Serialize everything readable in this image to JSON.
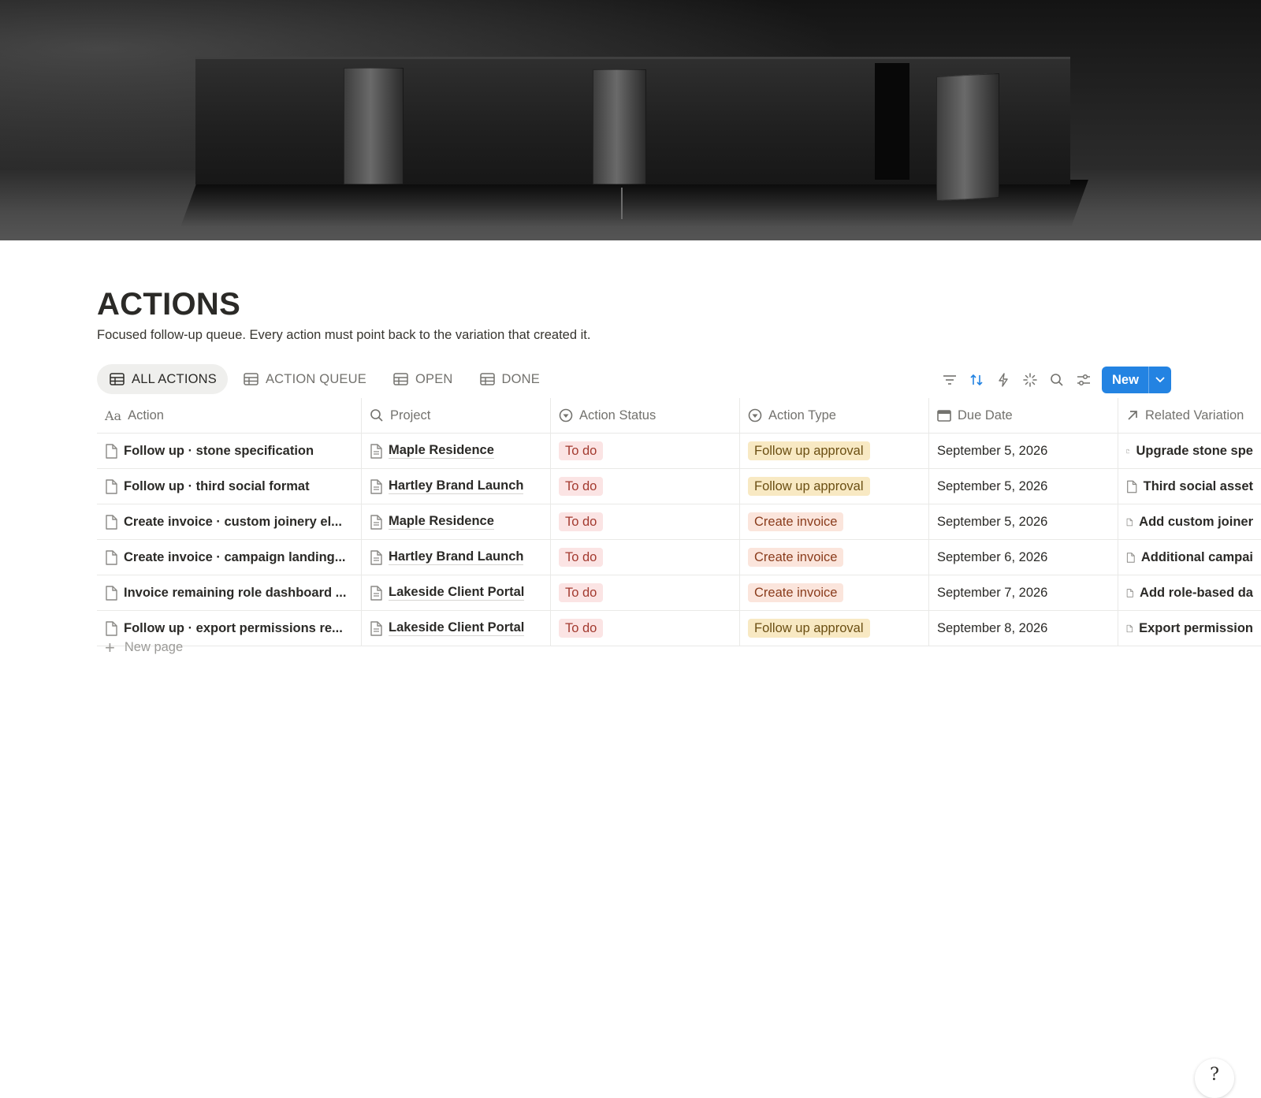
{
  "page": {
    "title": "ACTIONS",
    "description": "Focused follow-up queue. Every action must point back to the variation that created it."
  },
  "tabs": [
    {
      "label": "ALL ACTIONS",
      "active": true
    },
    {
      "label": "ACTION QUEUE",
      "active": false
    },
    {
      "label": "OPEN",
      "active": false
    },
    {
      "label": "DONE",
      "active": false
    }
  ],
  "toolbar": {
    "icons": [
      "filter-icon",
      "sort-icon",
      "automation-icon",
      "ai-sparkle-icon",
      "search-icon",
      "settings-icon"
    ],
    "new_label": "New",
    "accent": "#2383e2"
  },
  "columns": [
    {
      "label": "Action",
      "icon": "title-icon"
    },
    {
      "label": "Project",
      "icon": "search-icon"
    },
    {
      "label": "Action Status",
      "icon": "status-icon"
    },
    {
      "label": "Action Type",
      "icon": "select-icon"
    },
    {
      "label": "Due Date",
      "icon": "calendar-icon"
    },
    {
      "label": "Related Variation",
      "icon": "relation-arrow-icon"
    }
  ],
  "rows": [
    {
      "action": "Follow up · stone specification",
      "project": "Maple Residence",
      "status": "To do",
      "type": "Follow up approval",
      "type_color": "yellow",
      "due": "September 5, 2026",
      "variation": "Upgrade stone spe"
    },
    {
      "action": "Follow up · third social format",
      "project": "Hartley Brand Launch",
      "status": "To do",
      "type": "Follow up approval",
      "type_color": "yellow",
      "due": "September 5, 2026",
      "variation": "Third social asset"
    },
    {
      "action": "Create invoice · custom joinery el...",
      "project": "Maple Residence",
      "status": "To do",
      "type": "Create invoice",
      "type_color": "orange",
      "due": "September 5, 2026",
      "variation": "Add custom joiner"
    },
    {
      "action": "Create invoice · campaign landing...",
      "project": "Hartley Brand Launch",
      "status": "To do",
      "type": "Create invoice",
      "type_color": "orange",
      "due": "September 6, 2026",
      "variation": "Additional campai"
    },
    {
      "action": "Invoice remaining role dashboard ...",
      "project": "Lakeside Client Portal",
      "status": "To do",
      "type": "Create invoice",
      "type_color": "orange",
      "due": "September 7, 2026",
      "variation": "Add role-based da"
    },
    {
      "action": "Follow up · export permissions re...",
      "project": "Lakeside Client Portal",
      "status": "To do",
      "type": "Follow up approval",
      "type_color": "yellow",
      "due": "September 8, 2026",
      "variation": "Export permission"
    }
  ],
  "new_page_label": "New page",
  "help_glyph": "?"
}
